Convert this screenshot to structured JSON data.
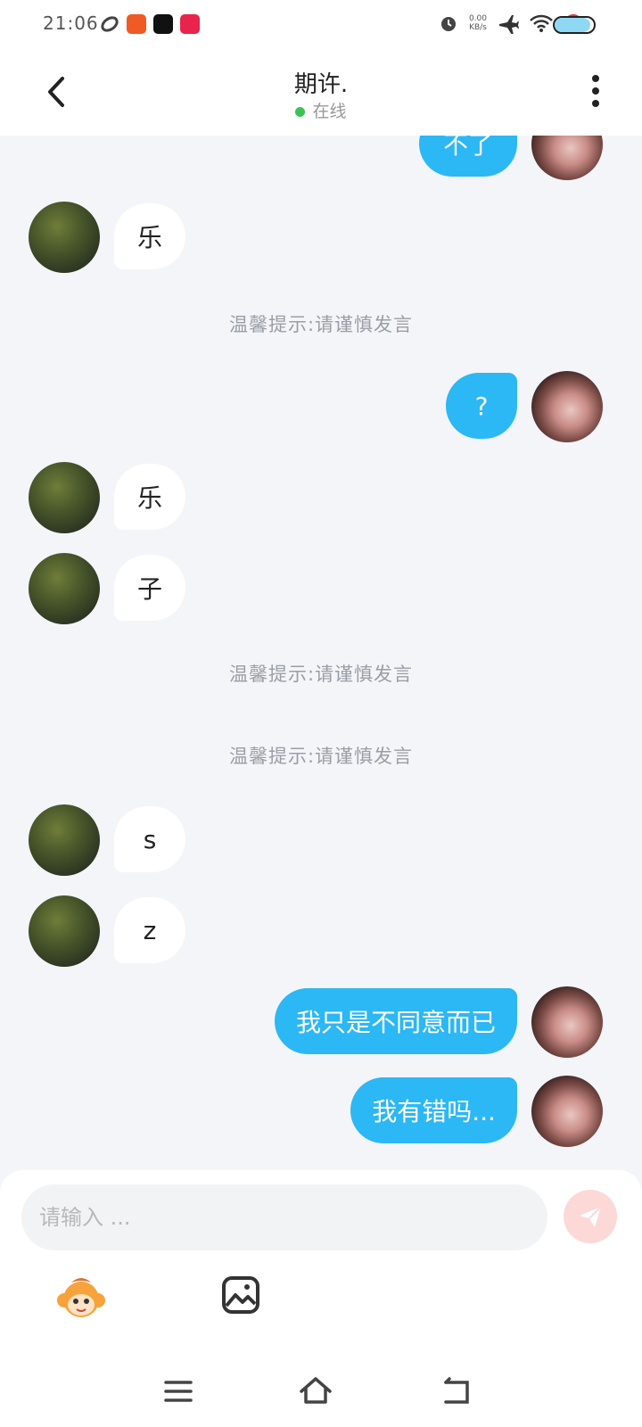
{
  "status_bar": {
    "time": "21:06",
    "net_speed": "0.00",
    "net_unit": "KB/s",
    "app_icons": [
      "app-icon-1",
      "app-icon-2",
      "app-icon-3",
      "app-icon-4"
    ],
    "battery_level": 0.9
  },
  "header": {
    "title": "期许.",
    "status": "在线"
  },
  "messages": [
    {
      "side": "out",
      "text": "不了"
    },
    {
      "side": "in",
      "text": "乐"
    },
    {
      "side": "system",
      "text": "温馨提示:请谨慎发言"
    },
    {
      "side": "out",
      "text": "?"
    },
    {
      "side": "in",
      "text": "乐"
    },
    {
      "side": "in",
      "text": "子"
    },
    {
      "side": "system",
      "text": "温馨提示:请谨慎发言"
    },
    {
      "side": "system",
      "text": "温馨提示:请谨慎发言"
    },
    {
      "side": "in",
      "text": "s"
    },
    {
      "side": "in",
      "text": "z"
    },
    {
      "side": "out",
      "text": "我只是不同意而已"
    },
    {
      "side": "out",
      "text": "我有错吗..."
    }
  ],
  "composer": {
    "placeholder": "请输入 ...",
    "value": ""
  },
  "colors": {
    "accent": "#2cb7f5",
    "online": "#3cc252",
    "send_button": "#fcd9d7",
    "background": "#f3f5f8"
  }
}
